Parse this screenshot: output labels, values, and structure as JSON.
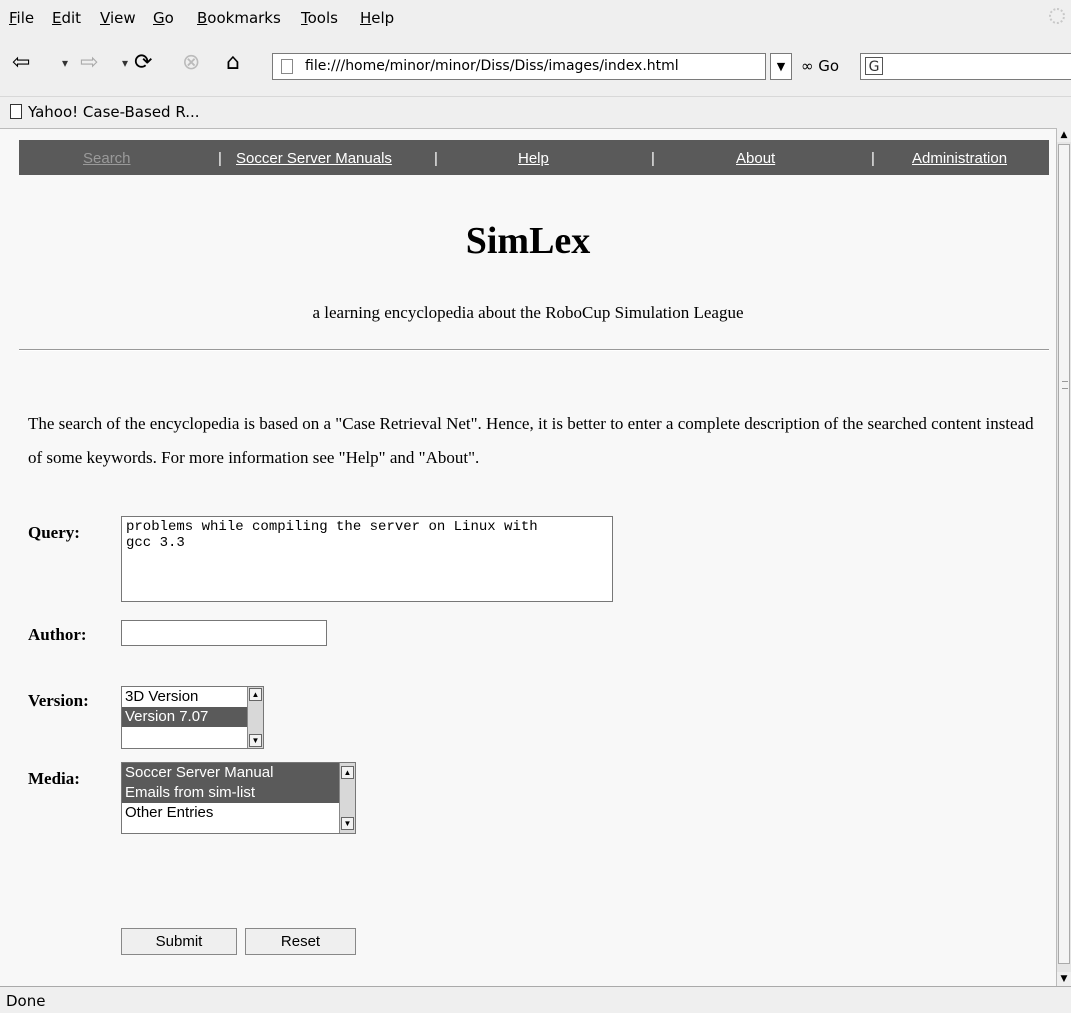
{
  "menu": {
    "items": [
      "File",
      "Edit",
      "View",
      "Go",
      "Bookmarks",
      "Tools",
      "Help"
    ]
  },
  "toolbar": {
    "url": "file:///home/minor/minor/Diss/Diss/images/index.html",
    "go_label": "Go",
    "icons": [
      "back-arrow",
      "forward-arrow",
      "reload",
      "stop",
      "home",
      "page",
      "dropdown",
      "google-search"
    ]
  },
  "bookmarks": {
    "items": [
      "Yahoo! Case-Based R..."
    ]
  },
  "site_nav": {
    "items": [
      "Search",
      "Soccer Server Manuals",
      "Help",
      "About",
      "Administration"
    ],
    "current": "Search",
    "separator": "|",
    "bar_color": "#5a5a5a"
  },
  "page": {
    "title": "SimLex",
    "subtitle": "a learning encyclopedia about the RoboCup Simulation League",
    "intro": "The search of the encyclopedia is based on a \"Case Retrieval Net\". Hence, it is better to enter a complete description of the searched content instead of some keywords. For more information see \"Help\" and \"About\"."
  },
  "form": {
    "query_label": "Query:",
    "query_value": "problems while compiling the server on Linux with\ngcc 3.3",
    "author_label": "Author:",
    "author_value": "",
    "version_label": "Version:",
    "version_options": [
      {
        "label": "3D Version",
        "selected": false
      },
      {
        "label": "Version 7.07",
        "selected": true
      }
    ],
    "media_label": "Media:",
    "media_options": [
      {
        "label": "Soccer Server Manual",
        "selected": true
      },
      {
        "label": "Emails from sim-list",
        "selected": true
      },
      {
        "label": "Other Entries",
        "selected": false
      }
    ],
    "submit_label": "Submit",
    "reset_label": "Reset"
  },
  "status": {
    "text": "Done"
  },
  "colors": {
    "selected_option": "#5a5a5a",
    "chrome_bg": "#efefef"
  }
}
